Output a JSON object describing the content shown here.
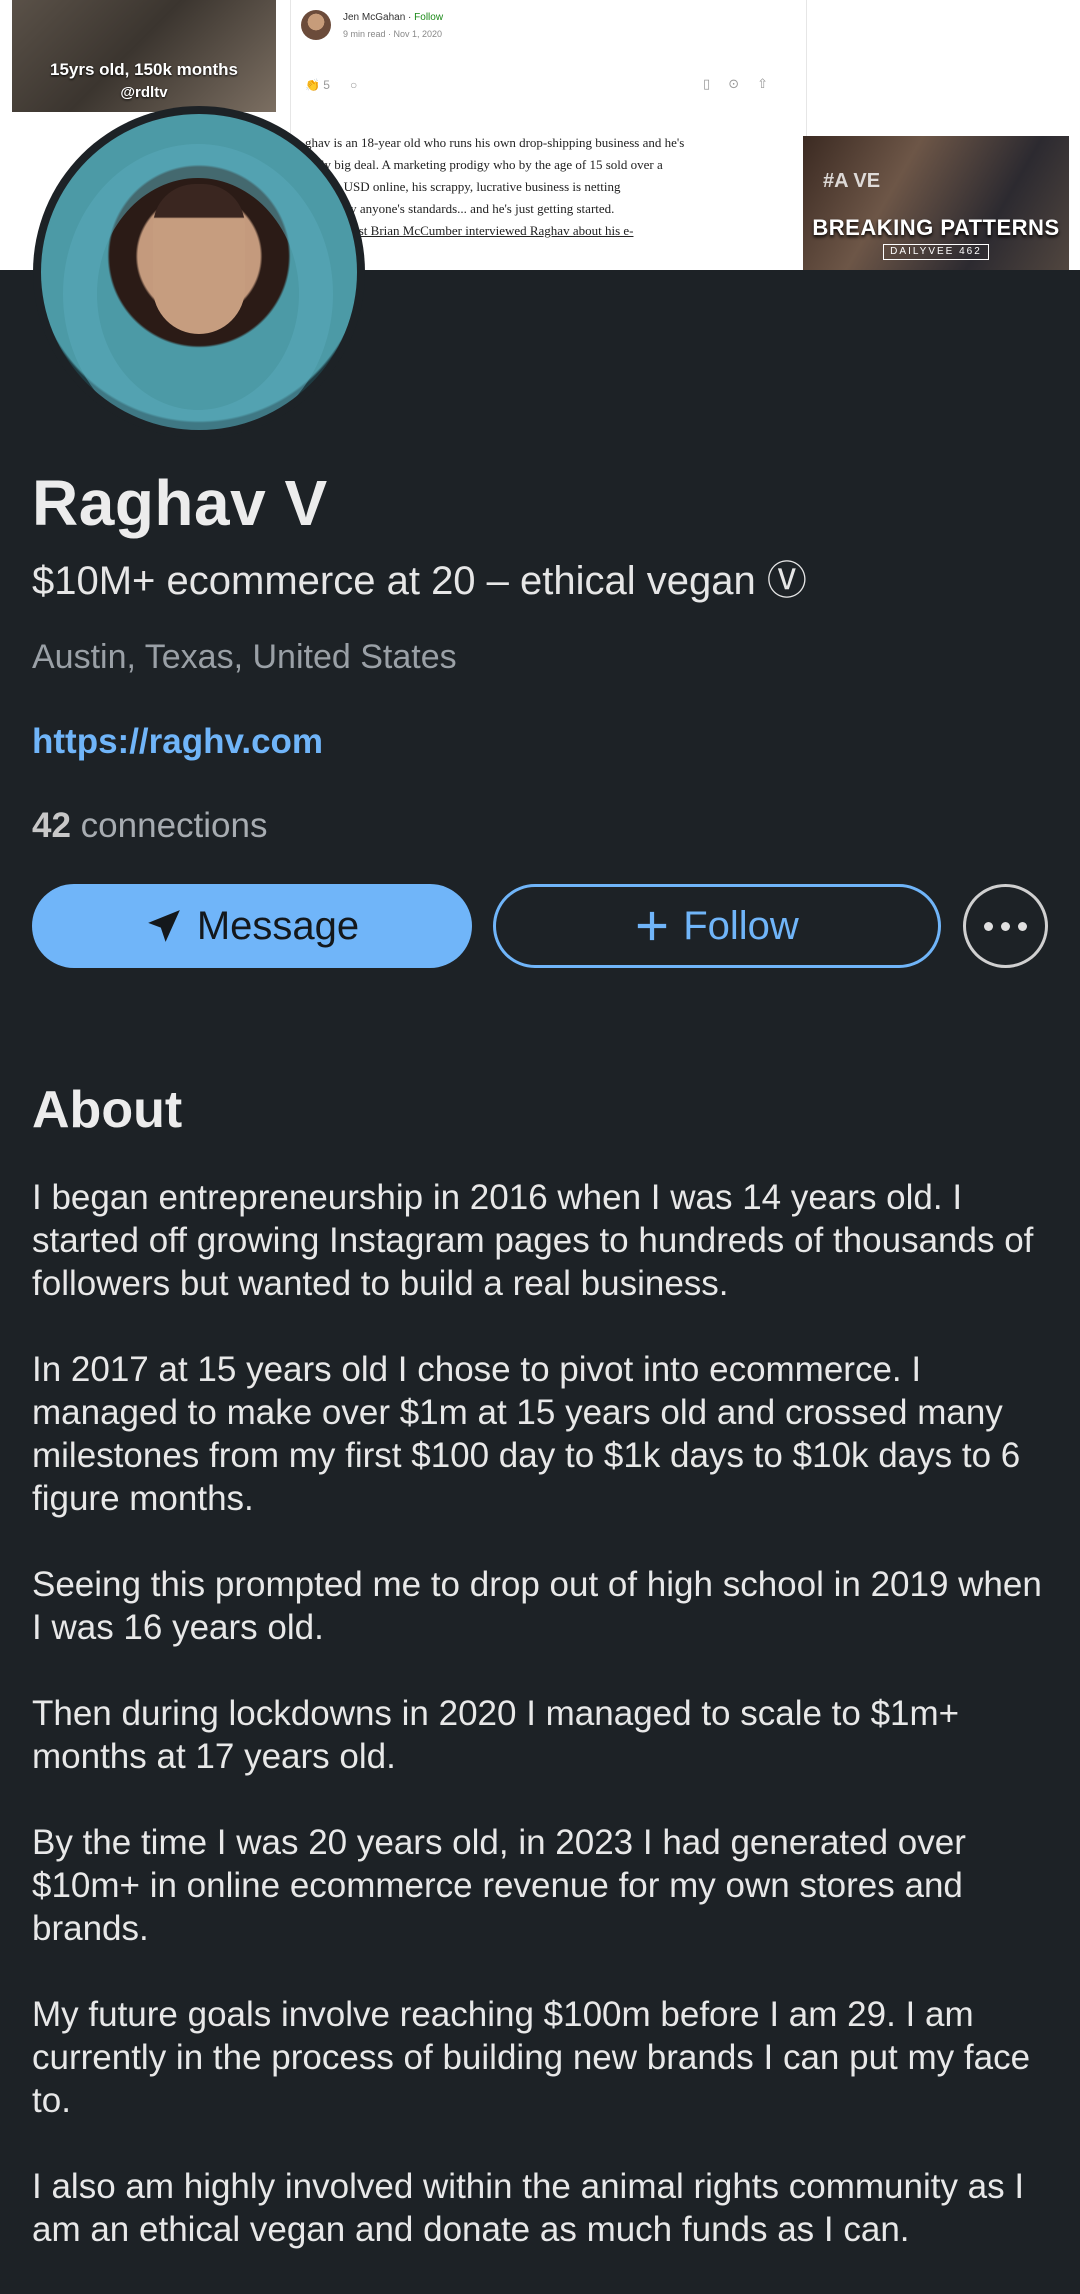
{
  "banner": {
    "left_caption_1": "15yrs old, 150k months",
    "left_caption_2": "@rdltv",
    "article": {
      "author": "Jen McGahan",
      "follow": "Follow",
      "meta": "9 min read · Nov 1, 2020",
      "claps": "5",
      "lines": [
        "ghav is an 18-year old who runs his own drop-shipping business and he's",
        "ually big deal. A marketing prodigy who by the age of 15 sold over a",
        "dollars USD online, his scrappy, lucrative business is netting",
        "money by anyone's standards... and he's just getting started.",
        "y Talks host Brian McCumber interviewed Raghav about his e-"
      ]
    },
    "thumb_title": "BREAKING PATTERNS",
    "thumb_sub": "DAILYVEE 462",
    "thumb_tag": "#A VE"
  },
  "profile": {
    "name": "Raghav V",
    "headline": "$10M+ ecommerce at 20 – ethical vegan Ⓥ",
    "location": "Austin, Texas, United States",
    "website": "https://raghv.com",
    "connections_count": "42",
    "connections_label": "connections"
  },
  "actions": {
    "message_label": "Message",
    "follow_label": "Follow"
  },
  "about": {
    "title": "About",
    "paragraphs": [
      "I began entrepreneurship in 2016 when I was 14 years old. I started off growing Instagram pages to hundreds of thousands of followers but wanted to build a real business.",
      "In 2017 at 15 years old I chose to pivot into ecommerce. I managed to make over $1m at 15 years old and crossed many milestones from my first $100 day to $1k days to $10k days to 6 figure months.",
      "Seeing this prompted me to drop out of high school in 2019 when I was 16 years old.",
      "Then during lockdowns in 2020 I managed to scale to $1m+ months at 17 years old.",
      "By the time I was 20 years old, in 2023 I had generated over $10m+ in online ecommerce revenue for my own stores and brands.",
      "My future goals involve reaching $100m before I am 29. I am currently in the process of building new brands I can put my face to.",
      "I also am highly involved within the animal rights community as I am an ethical vegan and donate as much funds as I can."
    ]
  },
  "colors": {
    "background": "#1d2226",
    "accent": "#70b5f9"
  },
  "icons": {
    "message": "send-icon",
    "follow": "plus-icon",
    "more": "more-icon"
  }
}
